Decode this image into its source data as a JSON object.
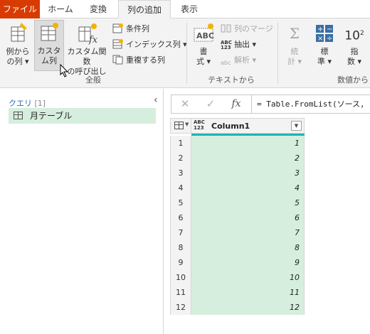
{
  "tabs": [
    {
      "label": "ファイル"
    },
    {
      "label": "ホーム"
    },
    {
      "label": "変換"
    },
    {
      "label": "列の追加"
    },
    {
      "label": "表示"
    }
  ],
  "ribbon": {
    "general": {
      "group_label": "全般",
      "example_line1": "例から",
      "example_line2": "の列 ▾",
      "custom_line1": "カスタ",
      "custom_line2": "ム列",
      "invoke_line1": "カスタム関数",
      "invoke_line2": "の呼び出し",
      "conditional": "条件列",
      "index": "インデックス列 ▾",
      "duplicate": "重複する列"
    },
    "text": {
      "group_label": "テキストから",
      "format_line1": "書",
      "format_line2": "式 ▾",
      "merge": "列のマージ",
      "extract": "抽出 ▾",
      "parse": "解析 ▾"
    },
    "number": {
      "group_label": "数値から",
      "stats_line1": "統",
      "stats_line2": "計 ▾",
      "std_line1": "標",
      "std_line2": "準 ▾",
      "sci_line1": "指",
      "sci_line2": "数 ▾"
    }
  },
  "queries": {
    "header": "クエリ",
    "count": "[1]",
    "items": [
      {
        "label": "月テーブル"
      }
    ]
  },
  "formula_bar": {
    "fx_label": "fx",
    "formula": "= Table.FromList(ソース,"
  },
  "grid": {
    "type_label_top": "ABC",
    "type_label_bottom": "123",
    "column_header": "Column1",
    "row_numbers": [
      "1",
      "2",
      "3",
      "4",
      "5",
      "6",
      "7",
      "8",
      "9",
      "10",
      "11",
      "12"
    ],
    "values": [
      "1",
      "2",
      "3",
      "4",
      "5",
      "6",
      "7",
      "8",
      "9",
      "10",
      "11",
      "12"
    ]
  },
  "colors": {
    "file_tab": "#d83b01",
    "selection": "#d6eedd",
    "column_accent": "#1fb5ad"
  }
}
